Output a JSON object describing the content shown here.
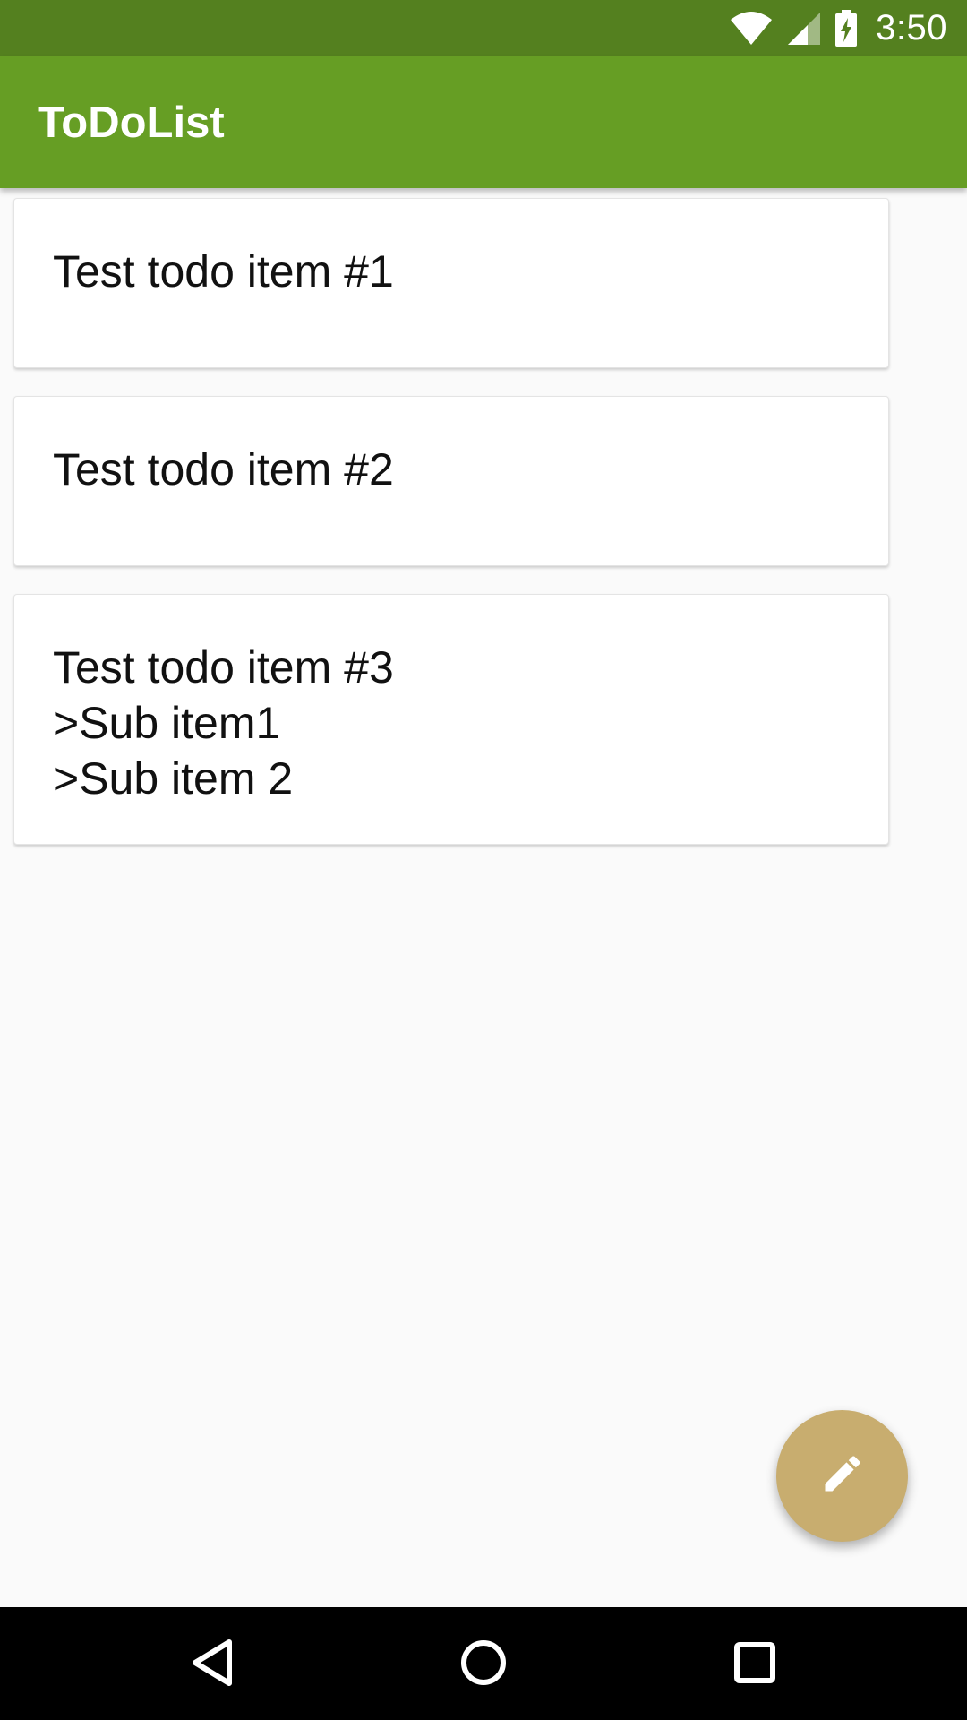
{
  "status_bar": {
    "time": "3:50",
    "icons": [
      "wifi-icon",
      "cell-signal-icon",
      "battery-charging-icon"
    ]
  },
  "app_bar": {
    "title": "ToDoList"
  },
  "todos": [
    {
      "text": "Test todo item #1"
    },
    {
      "text": "Test todo item #2"
    },
    {
      "text": "Test todo item #3\n>Sub item1\n>Sub item 2"
    }
  ],
  "fab": {
    "icon": "edit-pencil-icon"
  },
  "navigation": {
    "buttons": [
      "back-icon",
      "home-icon",
      "recents-icon"
    ]
  },
  "colors": {
    "status_bar": "#54801f",
    "app_bar": "#669e24",
    "fab": "#c8ad6f",
    "background": "#fafafa"
  }
}
